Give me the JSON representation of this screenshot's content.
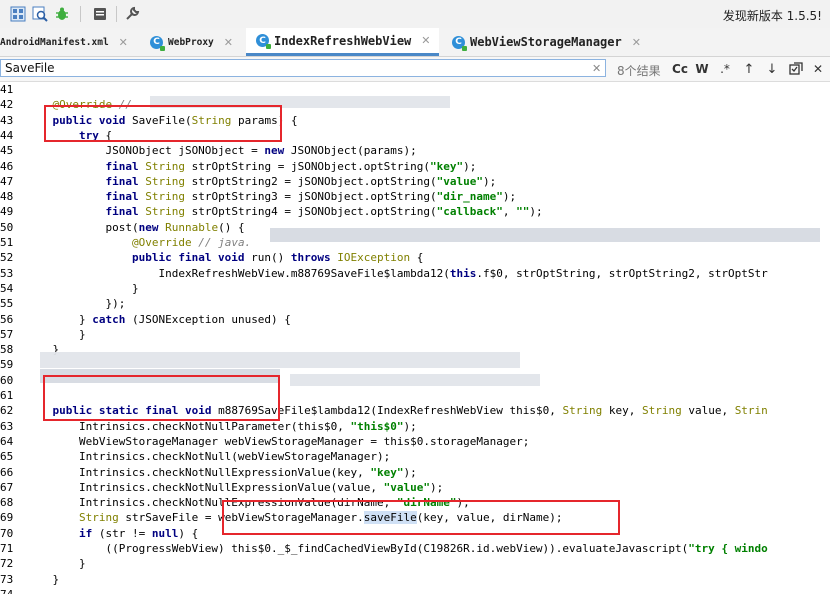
{
  "toolbar": {
    "update_text": "发现新版本 1.5.5!"
  },
  "tabs": [
    {
      "label": "AndroidManifest.xml",
      "icon": "",
      "active": false
    },
    {
      "label": "WebProxy",
      "icon": "class-icon",
      "active": false
    },
    {
      "label": "IndexRefreshWebView",
      "icon": "class-icon",
      "active": true
    },
    {
      "label": "WebViewStorageManager",
      "icon": "class-icon",
      "active": false
    }
  ],
  "search": {
    "value": "SaveFile",
    "match_count": "8个结果",
    "case_label": "Cc",
    "word_label": "W",
    "regex_label": ".*",
    "up_label": "↑",
    "down_label": "↓"
  },
  "code_lines": [
    {
      "n": "41",
      "html": ""
    },
    {
      "n": "42",
      "html": "    <span class=\"an\">@Override</span> <span class=\"cm\">//</span>"
    },
    {
      "n": "43",
      "html": "    <span class=\"kw\">public void</span> SaveFile(<span class=\"an\">String</span> params) {"
    },
    {
      "n": "44",
      "html": "        <span class=\"kw\">try</span> {"
    },
    {
      "n": "45",
      "html": "            JSONObject jSONObject = <span class=\"kw\">new</span> JSONObject(params);"
    },
    {
      "n": "46",
      "html": "            <span class=\"kw\">final</span> <span class=\"an\">String</span> strOptString = jSONObject.optString(<span class=\"st\">\"key\"</span>);"
    },
    {
      "n": "47",
      "html": "            <span class=\"kw\">final</span> <span class=\"an\">String</span> strOptString2 = jSONObject.optString(<span class=\"st\">\"value\"</span>);"
    },
    {
      "n": "48",
      "html": "            <span class=\"kw\">final</span> <span class=\"an\">String</span> strOptString3 = jSONObject.optString(<span class=\"st\">\"dir_name\"</span>);"
    },
    {
      "n": "49",
      "html": "            <span class=\"kw\">final</span> <span class=\"an\">String</span> strOptString4 = jSONObject.optString(<span class=\"st\">\"callback\"</span>, <span class=\"st\">\"\"</span>);"
    },
    {
      "n": "50",
      "html": "            post(<span class=\"kw\">new</span> <span class=\"an\">Runnable</span>() {"
    },
    {
      "n": "51",
      "html": "                <span class=\"an\">@Override</span> <span class=\"cm\">// java.</span>"
    },
    {
      "n": "52",
      "html": "                <span class=\"kw\">public final void</span> run() <span class=\"kw\">throws</span> <span class=\"an\">IOException</span> {"
    },
    {
      "n": "53",
      "html": "                    IndexRefreshWebView.m88769SaveFile$lambda12(<span class=\"kw\">this</span>.f$0, strOptString, strOptString2, strOptStr"
    },
    {
      "n": "54",
      "html": "                }"
    },
    {
      "n": "55",
      "html": "            });"
    },
    {
      "n": "56",
      "html": "        } <span class=\"kw\">catch</span> (JSONException unused) {"
    },
    {
      "n": "57",
      "html": "        }"
    },
    {
      "n": "58",
      "html": "    }"
    },
    {
      "n": "59",
      "html": ""
    },
    {
      "n": "60",
      "html": ""
    },
    {
      "n": "61",
      "html": ""
    },
    {
      "n": "62",
      "html": "    <span class=\"kw\">public static final void</span> m88769SaveFile$lambda12(IndexRefreshWebView this$0, <span class=\"an\">String</span> key, <span class=\"an\">String</span> value, <span class=\"an\">Strin</span>"
    },
    {
      "n": "63",
      "html": "        Intrinsics.checkNotNullParameter(this$0, <span class=\"st\">\"this$0\"</span>);"
    },
    {
      "n": "64",
      "html": "        WebViewStorageManager webViewStorageManager = this$0.storageManager;"
    },
    {
      "n": "65",
      "html": "        Intrinsics.checkNotNull(webViewStorageManager);"
    },
    {
      "n": "66",
      "html": "        Intrinsics.checkNotNullExpressionValue(key, <span class=\"st\">\"key\"</span>);"
    },
    {
      "n": "67",
      "html": "        Intrinsics.checkNotNullExpressionValue(value, <span class=\"st\">\"value\"</span>);"
    },
    {
      "n": "68",
      "html": "        Intrinsics.checkNotNullExpressionValue(dirName, <span class=\"st\">\"dirName\"</span>);"
    },
    {
      "n": "69",
      "html": "        <span class=\"an\">String</span> strSaveFile = webViewStorageManager.<span class=\"match-hl\">saveFile</span>(key, value, dirName);"
    },
    {
      "n": "70",
      "html": "        <span class=\"kw\">if</span> (str != <span class=\"kw\">null</span>) {"
    },
    {
      "n": "71",
      "html": "            ((ProgressWebView) this$0._$_findCachedViewById(C19826R.id.webView)).evaluateJavascript(<span class=\"st\">\"try { windo</span>"
    },
    {
      "n": "72",
      "html": "        }"
    },
    {
      "n": "73",
      "html": "    }"
    },
    {
      "n": "74",
      "html": ""
    }
  ],
  "colors": {
    "keyword": "#000080",
    "string": "#008000",
    "annotation": "#808000",
    "highlight_box": "#e5262c",
    "active_tab_underline": "#4a88c7"
  }
}
